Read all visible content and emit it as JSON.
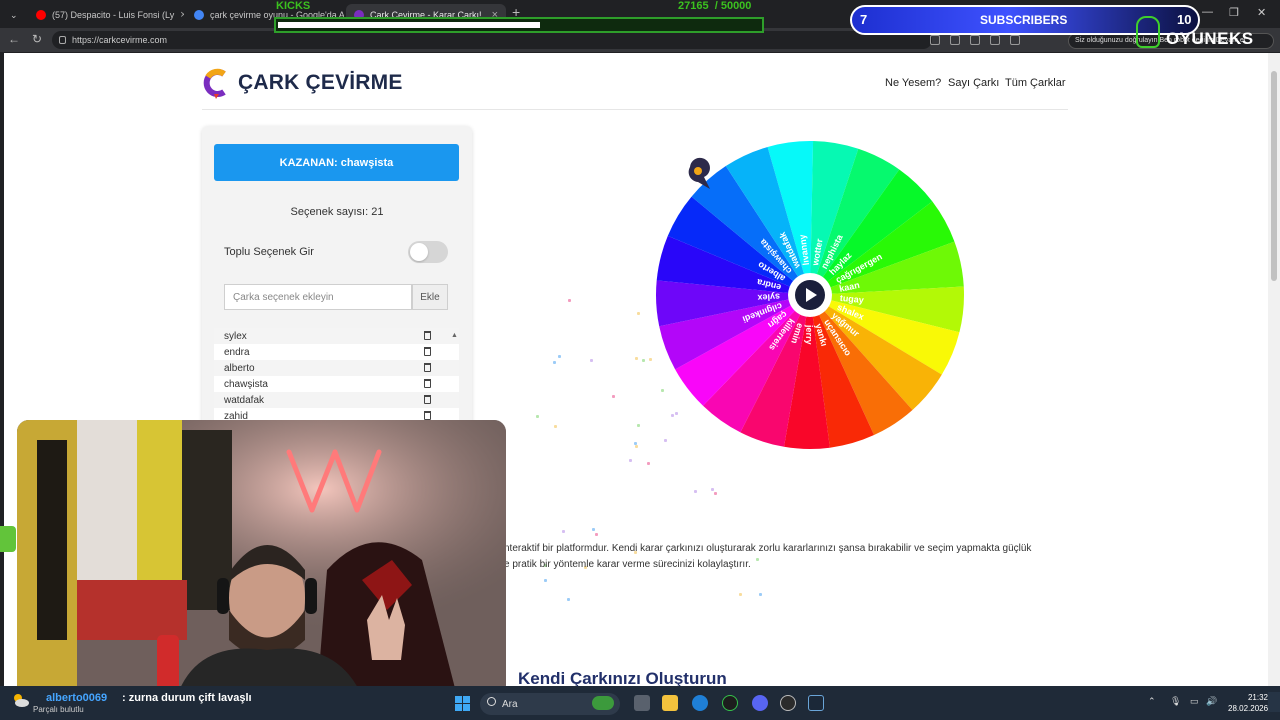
{
  "browser": {
    "tabs": [
      {
        "title": "(57) Despacito - Luis Fonsi (Ly",
        "favicon_color": "#ff0000"
      },
      {
        "title": "çark çevirme oyunu - Google'da A",
        "favicon_color": "#4285f4"
      },
      {
        "title": "Çark Çevirme - Karar Çarkı!",
        "favicon_color": "#7a2dbf"
      }
    ],
    "new_tab": "+",
    "url": "https://carkcevirme.com",
    "address_hint": "Siz olduğunuzu doğrulayın  Ben robot değilim  Devam et",
    "window_controls": [
      "—",
      "❐",
      "✕"
    ]
  },
  "site": {
    "brand": "ÇARK ÇEVİRME",
    "nav": [
      "Ne Yesem?",
      "Sayı Çarkı",
      "Tüm Çarklar"
    ],
    "winner_prefix": "KAZANAN:",
    "winner_name": "chawşista",
    "option_count_label": "Seçenek sayısı: 21",
    "bulk_label": "Toplu Seçenek Gir",
    "bulk_enabled": false,
    "input_placeholder": "Çarka seçenek ekleyin",
    "add_label": "Ekle",
    "list_items": [
      "sylex",
      "endra",
      "alberto",
      "chawşista",
      "watdafak",
      "zahid"
    ],
    "description_line1": "nteraktif bir platformdur. Kendi karar çarkınızı oluşturarak zorlu kararlarınızı şansa bırakabilir ve seçim yapmakta güçlük",
    "description_line2": "e pratik bir yöntemle karar verme sürecinizi kolaylaştırır.",
    "section_heading": "Kendi Çarkınızı Oluşturun",
    "accent_color": "#1a97ef"
  },
  "wheel": {
    "segments": [
      "lıvanny",
      "wotter",
      "nephista",
      "haylaz",
      "çağrıgergen",
      "kaan",
      "tugay",
      "shalex",
      "yağmur",
      "uçansıcıo",
      "yankı",
      "jerry",
      "emin",
      "killerreis",
      "çağrı",
      "cılgınkedi",
      "sylex",
      "endra",
      "alberto",
      "chawşista",
      "watdafak"
    ],
    "pointer_icon": "pointer-marker-icon",
    "center_icon": "play-icon"
  },
  "stream": {
    "kicks_label": "KICKS",
    "kicks_current": "27165",
    "kicks_goal": "/ 50000",
    "kicks_progress": 0.543,
    "subs_current": "7",
    "subs_label": "SUBSCRIBERS",
    "subs_goal": "10",
    "channel_logo": "OYUNEKS",
    "chat_user": "alberto0069",
    "chat_message": ": zurna durum çift lavaşlı",
    "weather": "Parçalı bulutlu"
  },
  "taskbar": {
    "search_label": "Ara",
    "time": "21:32",
    "date": "28.02.2026"
  }
}
